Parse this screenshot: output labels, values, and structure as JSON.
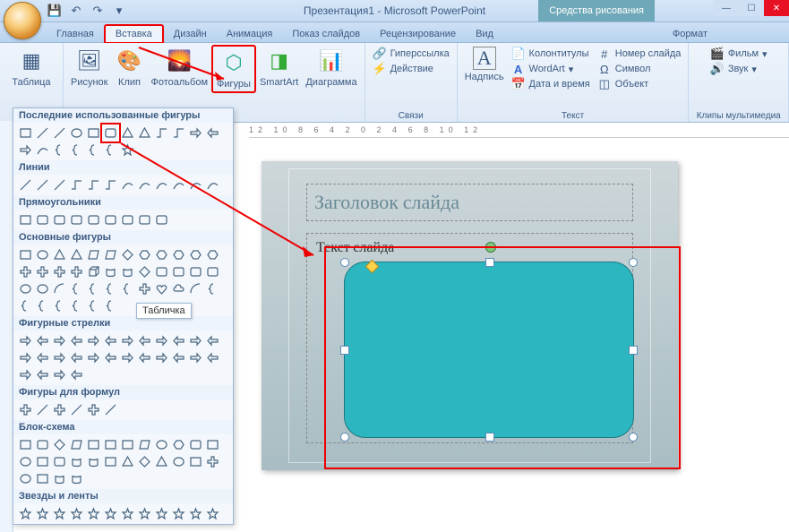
{
  "titlebar": {
    "title": "Презентация1 - Microsoft PowerPoint",
    "contextual": "Средства рисования"
  },
  "tabs": {
    "home": "Главная",
    "insert": "Вставка",
    "design": "Дизайн",
    "anim": "Анимация",
    "show": "Показ слайдов",
    "review": "Рецензирование",
    "view": "Вид",
    "format": "Формат"
  },
  "ribbon": {
    "table": "Таблица",
    "picture": "Рисунок",
    "clip": "Клип",
    "album": "Фотоальбом",
    "shapes": "Фигуры",
    "smartart": "SmartArt",
    "chart": "Диаграмма",
    "textbox": "Надпись",
    "hyperlink": "Гиперссылка",
    "action": "Действие",
    "headerfooter": "Колонтитулы",
    "slidenumber": "Номер слайда",
    "wordart": "WordArt",
    "symbol": "Символ",
    "datetime": "Дата и время",
    "object": "Объект",
    "movie": "Фильм",
    "sound": "Звук",
    "g_links": "Связи",
    "g_text": "Текст",
    "g_media": "Клипы мультимедиа"
  },
  "shapes_panel": {
    "recent": "Последние использованные фигуры",
    "lines": "Линии",
    "rects": "Прямоугольники",
    "basic": "Основные фигуры",
    "arrows": "Фигурные стрелки",
    "formulas": "Фигуры для формул",
    "flowchart": "Блок-схема",
    "stars": "Звезды и ленты"
  },
  "tooltip": "Табличка",
  "slide": {
    "title": "Заголовок слайда",
    "body": "Текст слайда"
  },
  "ruler": "12 10 8 6 4 2 0 2 4 6 8 10 12"
}
